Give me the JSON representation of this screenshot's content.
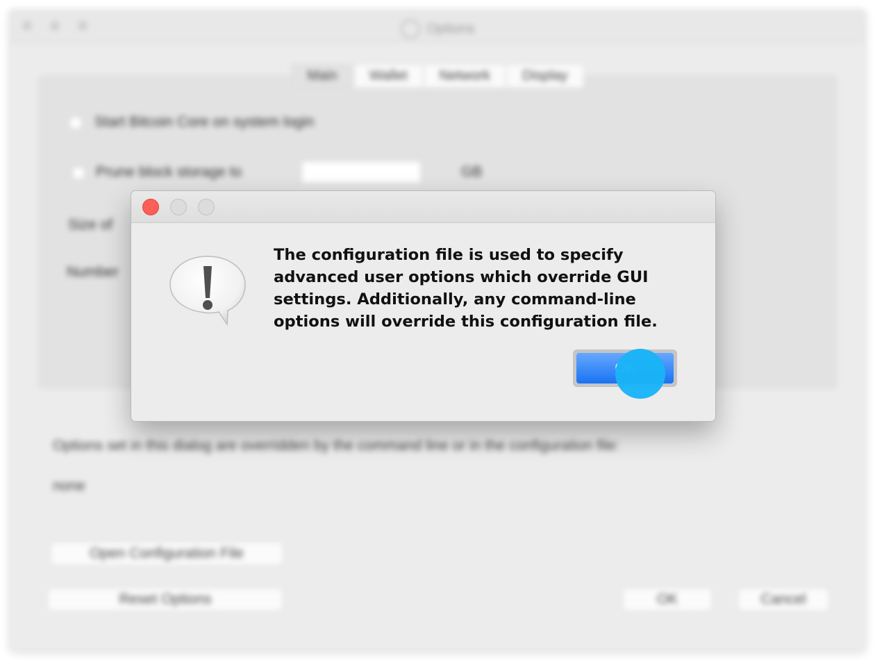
{
  "background_window": {
    "title": "Options",
    "tabs": [
      {
        "label": "Main",
        "selected": true
      },
      {
        "label": "Wallet",
        "selected": false
      },
      {
        "label": "Network",
        "selected": false
      },
      {
        "label": "Display",
        "selected": false
      }
    ],
    "start_on_login_label": "Start Bitcoin Core on system login",
    "prune_label": "Prune block storage to",
    "prune_unit": "GB",
    "size_label": "Size of",
    "number_label": "Number",
    "override_notice": "Options set in this dialog are overridden by the command line or in the configuration file:",
    "override_value": "none",
    "open_config_button": "Open Configuration File",
    "reset_button": "Reset Options",
    "ok_button": "OK",
    "cancel_button": "Cancel"
  },
  "alert": {
    "message": "The configuration file is used to specify advanced user options which override GUI settings. Additionally, any command-line options will override this configuration file.",
    "ok_button": "OK",
    "icon": "caution-icon"
  },
  "colors": {
    "close_light": "#fc5f57",
    "ok_button_blue": "#1a73f2",
    "click_indicator": "#1ab4f7"
  }
}
